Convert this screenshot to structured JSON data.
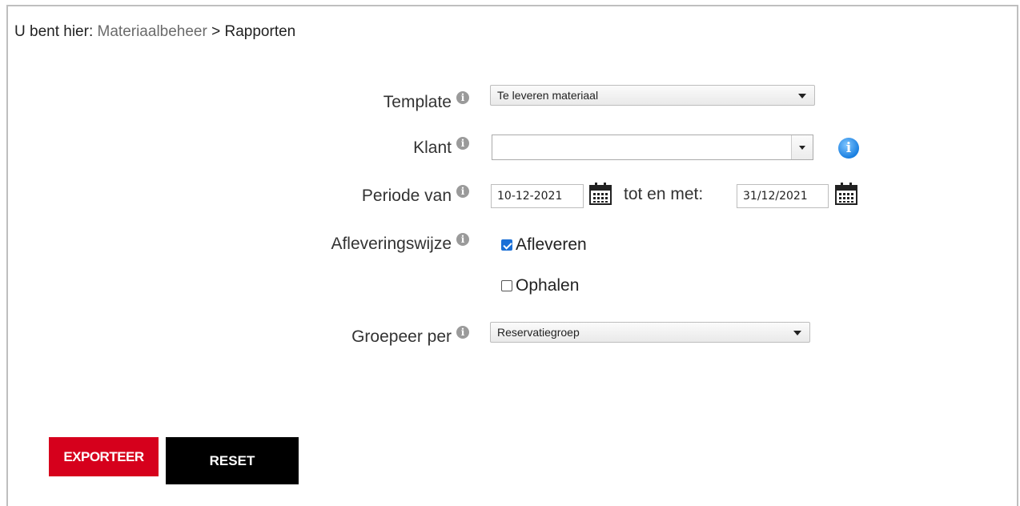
{
  "breadcrumb": {
    "prefix": "U bent hier:",
    "link": "Materiaalbeheer",
    "separator": ">",
    "current": "Rapporten"
  },
  "form": {
    "template": {
      "label": "Template",
      "value": "Te leveren materiaal"
    },
    "klant": {
      "label": "Klant",
      "value": ""
    },
    "periode": {
      "label": "Periode van",
      "from": "10-12-2021",
      "to_label": "tot en met:",
      "to": "31/12/2021"
    },
    "aflevering": {
      "label": "Afleveringswijze",
      "options": [
        {
          "label": "Afleveren",
          "checked": true
        },
        {
          "label": "Ophalen",
          "checked": false
        }
      ]
    },
    "groepeer": {
      "label": "Groepeer per",
      "value": "Reservatiegroep"
    }
  },
  "buttons": {
    "export": "EXPORTEER",
    "reset": "RESET"
  },
  "icons": {
    "info_gray": "info-icon",
    "info_blue": "info-circle-icon",
    "calendar": "calendar-icon"
  },
  "colors": {
    "export_button": "#d6001c",
    "reset_button": "#000000",
    "checkbox_checked": "#1a6fd6",
    "info_blue": "#1a7fe0"
  }
}
